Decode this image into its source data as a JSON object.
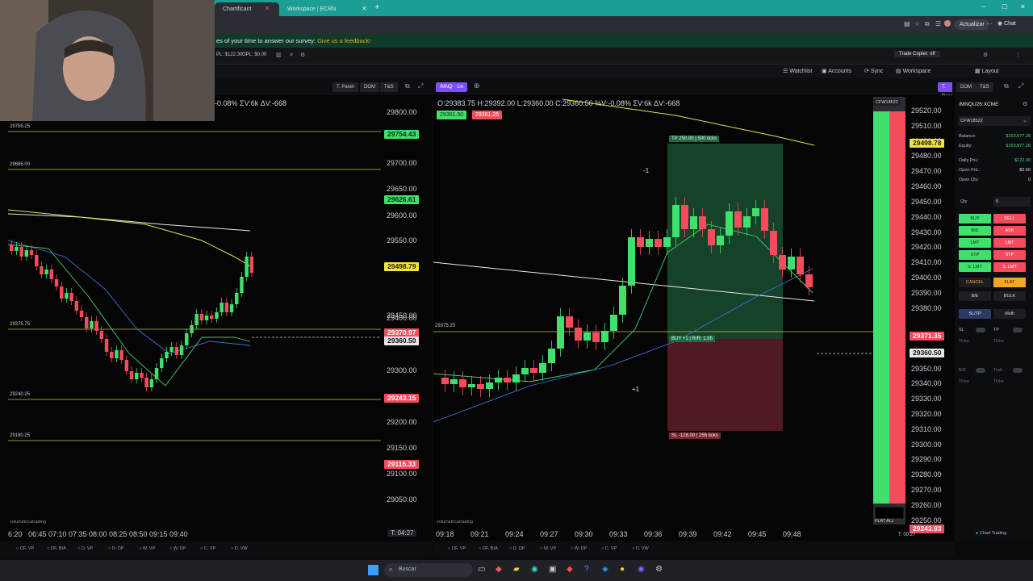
{
  "browser": {
    "tabs": [
      {
        "label": "Chartificant"
      },
      {
        "label": "Workspace | ECRN"
      }
    ],
    "update_button": "Actualizar",
    "chat_label": "Chat"
  },
  "survey": {
    "text": "es of your time to answer our survey:",
    "link": "Give us a feedback!"
  },
  "appbar": {
    "opl_left": "PL: $122.30",
    "opl": "OPL: $0.00",
    "trade_copier": "Trade Copier: off"
  },
  "topbar": {
    "watchlist": "Watchlist",
    "accounts": "Accounts",
    "sync": "Sync",
    "workspace": "Workspace",
    "layout": "Layout"
  },
  "left_chart": {
    "buttons": [
      "T. Panel",
      "DOM",
      "T&S"
    ],
    "ohlc": "-0.08%  ΣV:6k  ΔV:-668",
    "prices": [
      "29800.00",
      "29700.00",
      "29650.00",
      "29600.00",
      "29550.00",
      "29450.00",
      "29400.00",
      "29300.00",
      "29200.00",
      "29150.00",
      "29100.00",
      "29050.00"
    ],
    "level_labels": [
      "29759.25",
      "29686.00",
      "29375.75",
      "29240.25",
      "29160.25"
    ],
    "tags": {
      "green_top": "29754.43",
      "green_mid": "29626.61",
      "yellow": "29498.79",
      "red_last": "29370.97",
      "white_last": "29360.50",
      "red_low": "29243.15",
      "red_bottom": "29115.33"
    },
    "times": [
      "6:20",
      "06:45",
      "07:10",
      "07:35",
      "08:00",
      "08:25",
      "08:50",
      "09:15",
      "09:40"
    ],
    "timer": "T: 04:27",
    "brand": "volumetricatrading",
    "studies": [
      "OF. VP",
      "OF. B/A",
      "D. VP",
      "D. DP",
      "W. VP",
      "W. DP",
      "C. VP",
      "D. VW"
    ]
  },
  "right_chart": {
    "symbol": "/MNQ",
    "interval": "1m",
    "buttons": [
      "T. Panel",
      "DOM",
      "T&S"
    ],
    "ohlc": "O:29383.75  H:29392.00  L:29360.00  C:29360.50  %V:-0.08%  ΣV:6k  ΔV:-668",
    "bid_ask": [
      "29361.50",
      "29361.25"
    ],
    "tp_label": "TP 250.00 | 500 ticks",
    "sl_label": "SL -128.00 | 256 ticks",
    "entry_label": "BUY +1 | R/R: 1.95",
    "level_left": "29375.25",
    "minus_one": "-1",
    "plus_one": "+1",
    "prices": [
      "29520.00",
      "29510.00",
      "29490.00",
      "29480.00",
      "29470.00",
      "29460.00",
      "29450.00",
      "29440.00",
      "29430.00",
      "29420.00",
      "29410.00",
      "29400.00",
      "29390.00",
      "29380.00",
      "29350.00",
      "29340.00",
      "29330.00",
      "29320.00",
      "29310.00",
      "29300.00",
      "29290.00",
      "29280.00",
      "29270.00",
      "29260.00",
      "29250.00"
    ],
    "tags": {
      "yellow": "29498.78",
      "red_last": "29371.35",
      "white_last": "29360.50",
      "red_low": "29243.93"
    },
    "account_tag": "CFW18522",
    "flat_all": "FLAT ALL",
    "times": [
      "09:18",
      "09:21",
      "09:24",
      "09:27",
      "09:30",
      "09:33",
      "09:36",
      "09:39",
      "09:42",
      "09:45",
      "09:48"
    ],
    "timer": "T: 00:27",
    "brand": "volumetricatrading",
    "studies": [
      "OF. VP",
      "OF. B/A",
      "D. DP",
      "W. VP",
      "W. DP",
      "C. VP",
      "D. VW"
    ]
  },
  "trade_panel": {
    "symbol": "/MNQU26:XCME",
    "account": "CFW18522",
    "balance_label": "Balance:",
    "balance": "$153,877.26",
    "equity_label": "Equity:",
    "equity": "$153,877.26",
    "daily_pnl_label": "Daily PnL:",
    "daily_pnl": "$122.30",
    "open_pnl_label": "Open PnL:",
    "open_pnl": "$0.00",
    "open_qty_label": "Open Qty:",
    "open_qty": "0",
    "qty_label": "Qty",
    "qty_value": "5",
    "buttons": {
      "buy": "BUY",
      "sell": "SELL",
      "bid": "BID",
      "ask": "ASK",
      "lmt_b": "LMT",
      "lmt_s": "LMT",
      "stp_b": "STP",
      "stp_s": "STP",
      "slmt_b": "S. LMT",
      "slmt_s": "S. LMT",
      "cancel": "CANCEL",
      "flat": "FLAT",
      "be": "B/E",
      "bulk": "BULK",
      "sltp": "SL/TP",
      "multi": "Multi"
    },
    "sl": "SL",
    "tp": "TP",
    "be_short": "B/E",
    "trail": "Trail.",
    "ticks": "Ticks",
    "chart_trading": "Chart Trading"
  },
  "taskbar": {
    "search": "Buscar"
  }
}
